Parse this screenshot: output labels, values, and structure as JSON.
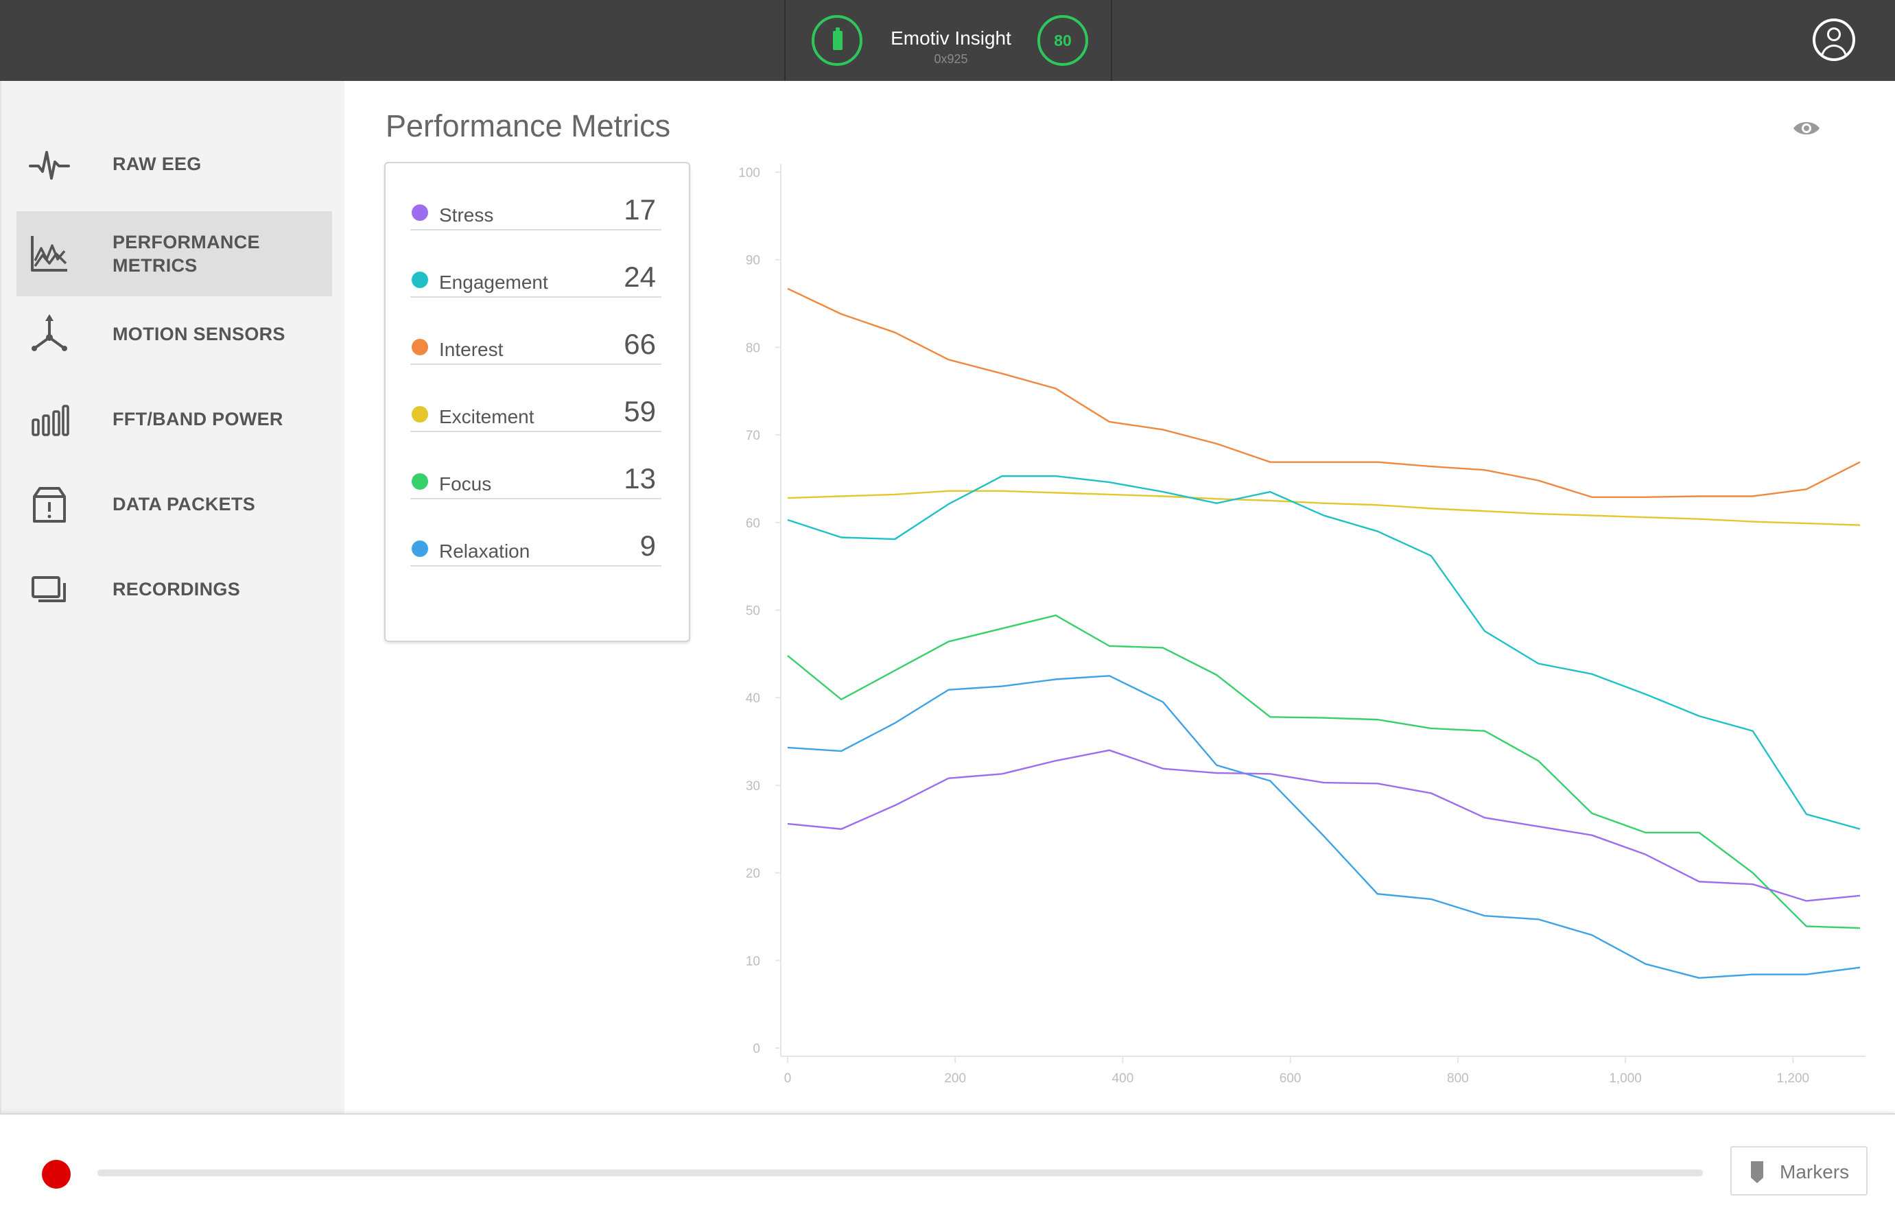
{
  "header": {
    "device_name": "Emotiv Insight",
    "device_id": "0x925",
    "battery_icon": "battery-icon",
    "signal_quality": "80",
    "account_icon": "account-icon"
  },
  "sidebar": {
    "items": [
      {
        "label": "RAW EEG",
        "icon": "waveform-icon"
      },
      {
        "label": "PERFORMANCE METRICS",
        "icon": "line-chart-icon",
        "active": true
      },
      {
        "label": "MOTION SENSORS",
        "icon": "axes-icon"
      },
      {
        "label": "FFT/BAND POWER",
        "icon": "bar-chart-icon"
      },
      {
        "label": "DATA PACKETS",
        "icon": "packet-box-icon"
      },
      {
        "label": "RECORDINGS",
        "icon": "recordings-icon"
      }
    ]
  },
  "main": {
    "title": "Performance Metrics",
    "visibility_icon": "eye-icon"
  },
  "metrics": [
    {
      "label": "Stress",
      "value": "17",
      "color": "#9d6df0"
    },
    {
      "label": "Engagement",
      "value": "24",
      "color": "#20c1c6"
    },
    {
      "label": "Interest",
      "value": "66",
      "color": "#f0883f"
    },
    {
      "label": "Excitement",
      "value": "59",
      "color": "#e3c72c"
    },
    {
      "label": "Focus",
      "value": "13",
      "color": "#37d06a"
    },
    {
      "label": "Relaxation",
      "value": "9",
      "color": "#3ea3e6"
    }
  ],
  "chart_data": {
    "type": "line",
    "title": "",
    "xlabel": "",
    "ylabel": "",
    "xlim": [
      0,
      1280
    ],
    "ylim": [
      0,
      100
    ],
    "x_ticks": [
      "0",
      "200",
      "400",
      "600",
      "800",
      "1,000",
      "1,200"
    ],
    "y_ticks": [
      "0",
      "10",
      "20",
      "30",
      "40",
      "50",
      "60",
      "70",
      "80",
      "90",
      "100"
    ],
    "grid": false,
    "legend": "none",
    "x": [
      0,
      64,
      128,
      192,
      256,
      320,
      384,
      448,
      512,
      576,
      640,
      704,
      768,
      832,
      896,
      960,
      1024,
      1088,
      1152,
      1216,
      1280
    ],
    "series": [
      {
        "name": "Interest",
        "color": "#f0883f",
        "values": [
          86.7,
          83.8,
          81.7,
          78.6,
          77.0,
          75.3,
          71.5,
          70.6,
          69.0,
          66.9,
          66.9,
          66.9,
          66.4,
          66.0,
          64.8,
          62.9,
          62.9,
          63.0,
          63.0,
          63.8,
          66.9
        ]
      },
      {
        "name": "Excitement",
        "color": "#e3c72c",
        "values": [
          62.8,
          63.0,
          63.2,
          63.6,
          63.6,
          63.4,
          63.2,
          63.0,
          62.7,
          62.5,
          62.2,
          62.0,
          61.6,
          61.3,
          61.0,
          60.8,
          60.6,
          60.4,
          60.1,
          59.9,
          59.7
        ]
      },
      {
        "name": "Engagement",
        "color": "#20c1c6",
        "values": [
          60.3,
          58.3,
          58.1,
          62.1,
          65.3,
          65.3,
          64.6,
          63.5,
          62.2,
          63.5,
          60.8,
          59.0,
          56.2,
          47.6,
          43.9,
          42.7,
          40.4,
          37.9,
          36.2,
          26.7,
          25.0
        ]
      },
      {
        "name": "Focus",
        "color": "#37d06a",
        "values": [
          44.8,
          39.8,
          43.1,
          46.4,
          47.9,
          49.4,
          45.9,
          45.7,
          42.6,
          37.8,
          37.7,
          37.5,
          36.5,
          36.2,
          32.8,
          26.8,
          24.6,
          24.6,
          20.0,
          13.9,
          13.7
        ]
      },
      {
        "name": "Relaxation",
        "color": "#3ea3e6",
        "values": [
          34.3,
          33.9,
          37.1,
          40.9,
          41.3,
          42.1,
          42.5,
          39.5,
          32.3,
          30.5,
          24.2,
          17.6,
          17.0,
          15.1,
          14.7,
          12.9,
          9.6,
          8.0,
          8.4,
          8.4,
          9.2
        ]
      },
      {
        "name": "Stress",
        "color": "#9d6df0",
        "values": [
          25.6,
          25.0,
          27.7,
          30.8,
          31.3,
          32.8,
          34.0,
          31.9,
          31.4,
          31.3,
          30.3,
          30.2,
          29.1,
          26.3,
          25.3,
          24.3,
          22.1,
          19.0,
          18.7,
          16.8,
          17.4
        ]
      }
    ]
  },
  "footer": {
    "record_button": "record-button",
    "markers_label": "Markers",
    "marker_icon": "marker-pin-icon"
  }
}
